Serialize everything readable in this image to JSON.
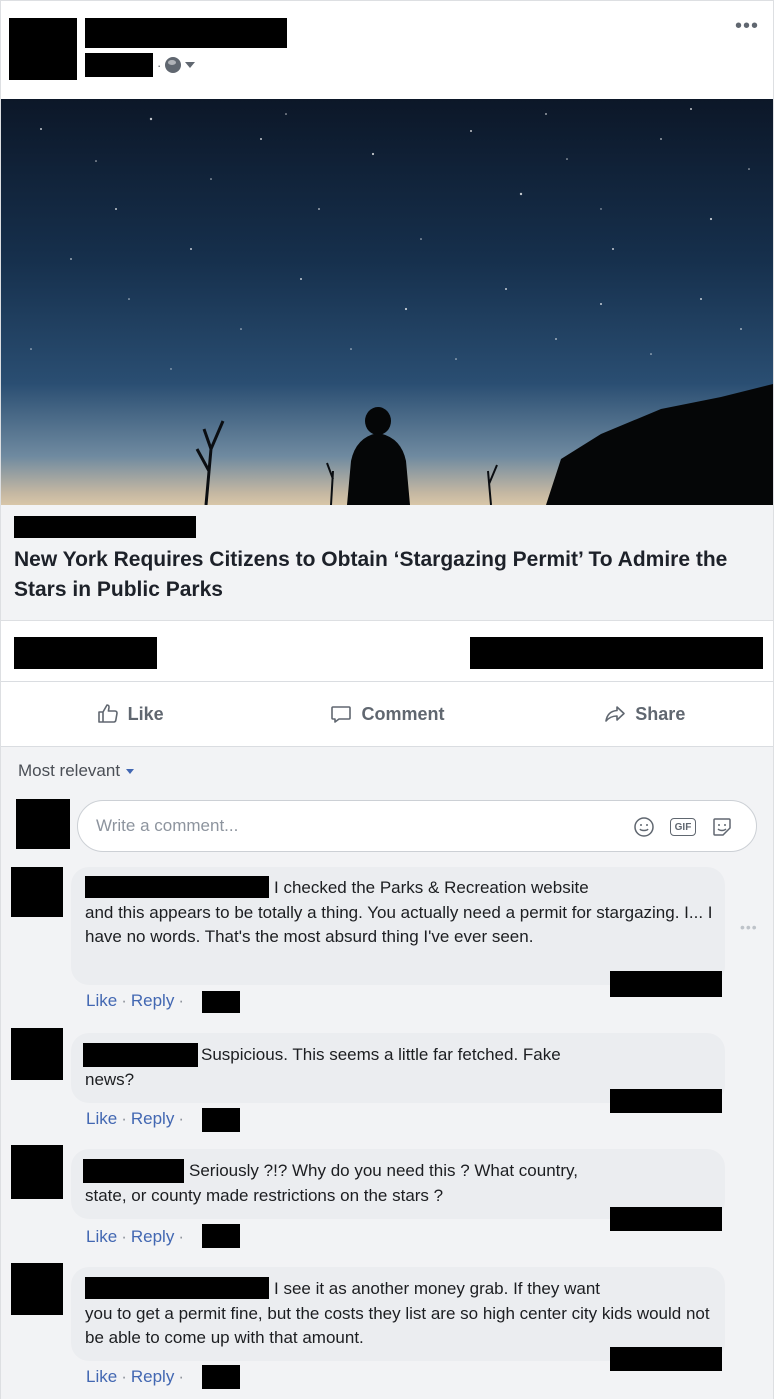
{
  "post": {
    "menu_glyph": "•••",
    "meta_separator": "·",
    "link_title": "New York Requires Citizens to Obtain ‘Stargazing Permit’ To Admire the Stars in Public Parks"
  },
  "actions": {
    "like_label": "Like",
    "comment_label": "Comment",
    "share_label": "Share"
  },
  "comments_section": {
    "sort_label": "Most relevant",
    "input_placeholder": "Write a comment...",
    "gif_label": "GIF",
    "comments": [
      {
        "text_line1": "I checked the Parks & Recreation website",
        "text_rest": "and this appears to be totally a thing. You actually need a permit for stargazing. I... I have no words. That's the most absurd thing I've ever seen.",
        "like": "Like",
        "reply": "Reply"
      },
      {
        "text_line1": "Suspicious. This seems a little far fetched. Fake",
        "text_rest": "news?",
        "like": "Like",
        "reply": "Reply"
      },
      {
        "text_line1": "Seriously ?!? Why do you need this ? What country,",
        "text_rest": "state, or county made restrictions on the stars ?",
        "like": "Like",
        "reply": "Reply"
      },
      {
        "text_line1": "I see it as another money grab. If they want",
        "text_rest": "you to get a permit fine, but the costs they list are so high center city kids would not be able to come up with that amount.",
        "like": "Like",
        "reply": "Reply"
      }
    ]
  },
  "colors": {
    "link_blue": "#4267b2",
    "muted_gray": "#606770"
  }
}
